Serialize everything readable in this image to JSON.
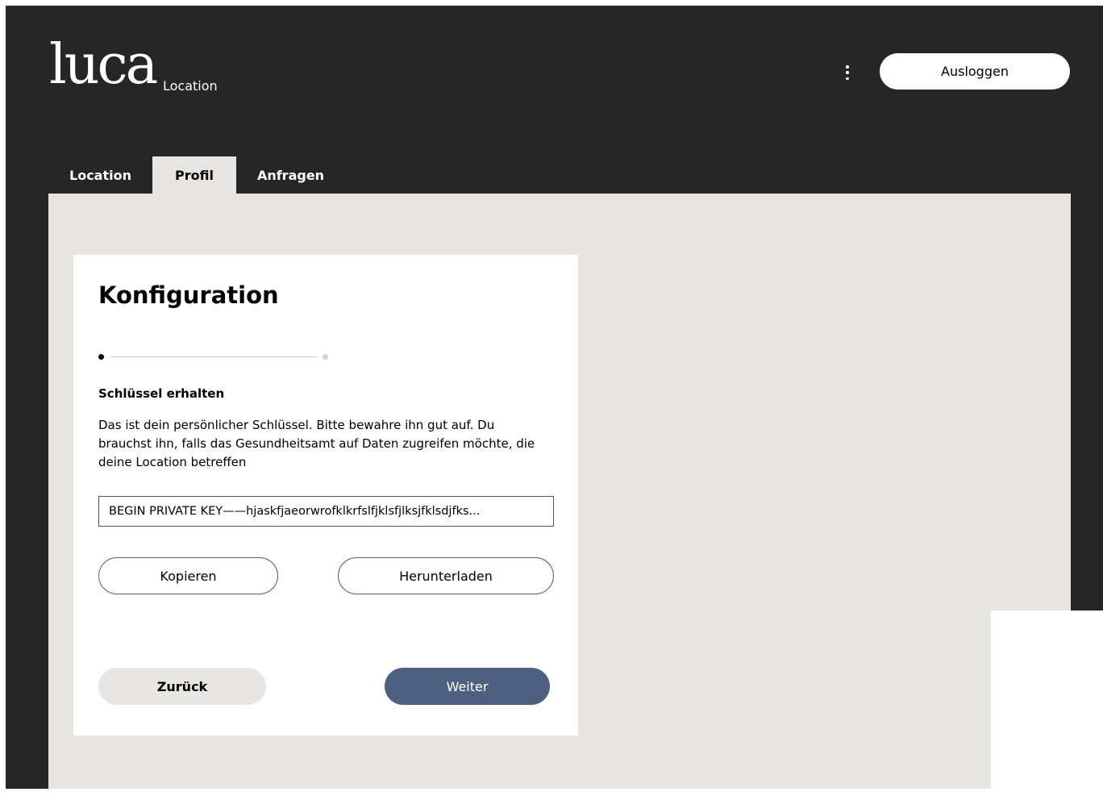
{
  "header": {
    "logo_text": "luca",
    "logo_subtitle": "Location",
    "menu_icon": "kebab-menu-icon",
    "logout_label": "Ausloggen"
  },
  "tabs": [
    {
      "label": "Location",
      "active": false
    },
    {
      "label": "Profil",
      "active": true
    },
    {
      "label": "Anfragen",
      "active": false
    }
  ],
  "card": {
    "title": "Konfiguration",
    "stepper": {
      "current_step": 1,
      "total_steps": 2
    },
    "section_title": "Schlüssel erhalten",
    "description": "Das ist dein persönlicher Schlüssel. Bitte bewahre ihn gut auf. Du brauchst ihn, falls das Gesundheitsamt auf Daten zugreifen möchte, die deine Location betreffen",
    "key_value": "BEGIN PRIVATE KEY——hjaskfjaeorwrofklkrfslfjklsfjlksjfklsdjfks...",
    "copy_label": "Kopieren",
    "download_label": "Herunterladen",
    "back_label": "Zurück",
    "next_label": "Weiter"
  },
  "colors": {
    "background_dark": "#262626",
    "content_bg": "#e8e6e3",
    "accent": "#4e6080",
    "card_bg": "#ffffff"
  }
}
